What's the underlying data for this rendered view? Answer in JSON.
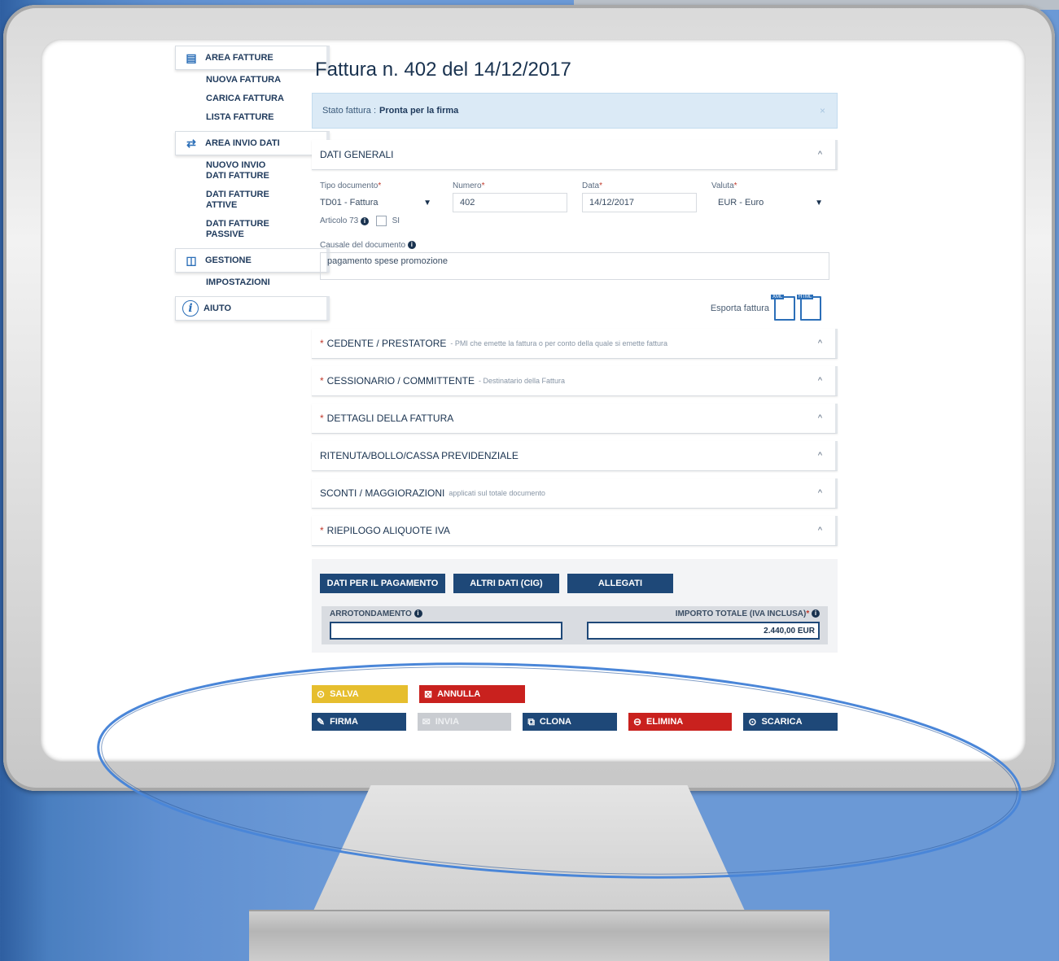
{
  "sidebar": {
    "area_fatture": "AREA FATTURE",
    "nuova_fattura": "NUOVA FATTURA",
    "carica_fattura": "CARICA FATTURA",
    "lista_fatture": "LISTA FATTURE",
    "area_invio_dati": "AREA INVIO DATI",
    "nuovo_invio_1": "NUOVO INVIO",
    "nuovo_invio_2": "DATI FATTURE",
    "dati_attive_1": "DATI FATTURE",
    "dati_attive_2": "ATTIVE",
    "dati_passive_1": "DATI FATTURE",
    "dati_passive_2": "PASSIVE",
    "gestione": "GESTIONE",
    "impostazioni": "IMPOSTAZIONI",
    "aiuto": "AIUTO"
  },
  "page": {
    "title": "Fattura n. 402 del 14/12/2017",
    "status_label": "Stato fattura :",
    "status_value": "Pronta per la firma"
  },
  "dati_generali": {
    "header": "DATI GENERALI",
    "tipo_label": "Tipo documento",
    "tipo_value": "TD01 - Fattura",
    "numero_label": "Numero",
    "numero_value": "402",
    "data_label": "Data",
    "data_value": "14/12/2017",
    "valuta_label": "Valuta",
    "valuta_value": "EUR - Euro",
    "articolo_label": "Articolo 73",
    "si_label": "SI",
    "causale_label": "Causale del documento",
    "causale_value": "pagamento spese promozione",
    "export_label": "Esporta fattura",
    "xml_tag": "XML",
    "html_tag": "HTML"
  },
  "sections": {
    "cedente": "CEDENTE / PRESTATORE",
    "cedente_sub": "- PMI che emette la fattura o per conto della quale si emette fattura",
    "cessionario": "CESSIONARIO / COMMITTENTE",
    "cessionario_sub": "- Destinatario della Fattura",
    "dettagli": "DETTAGLI DELLA FATTURA",
    "ritenuta": "RITENUTA/BOLLO/CASSA PREVIDENZIALE",
    "sconti": "SCONTI / MAGGIORAZIONI",
    "sconti_sub": "applicati sul totale documento",
    "riepilogo": "RIEPILOGO ALIQUOTE IVA"
  },
  "panel": {
    "btn_pagamento": "DATI PER IL PAGAMENTO",
    "btn_altri": "ALTRI DATI (CIG)",
    "btn_allegati": "ALLEGATI",
    "arrotondamento_label": "ARROTONDAMENTO",
    "importo_label": "IMPORTO TOTALE (IVA INCLUSA)",
    "importo_value": "2.440,00 EUR"
  },
  "actions": {
    "salva": "SALVA",
    "annulla": "ANNULLA",
    "firma": "FIRMA",
    "invia": "INVIA",
    "clona": "CLONA",
    "elimina": "ELIMINA",
    "scarica": "SCARICA"
  },
  "colors": {
    "accent": "#1e4878",
    "save": "#e6be2e",
    "danger": "#c9211e",
    "disabled": "#c9ccd1",
    "highlight": "#4a86d8"
  }
}
